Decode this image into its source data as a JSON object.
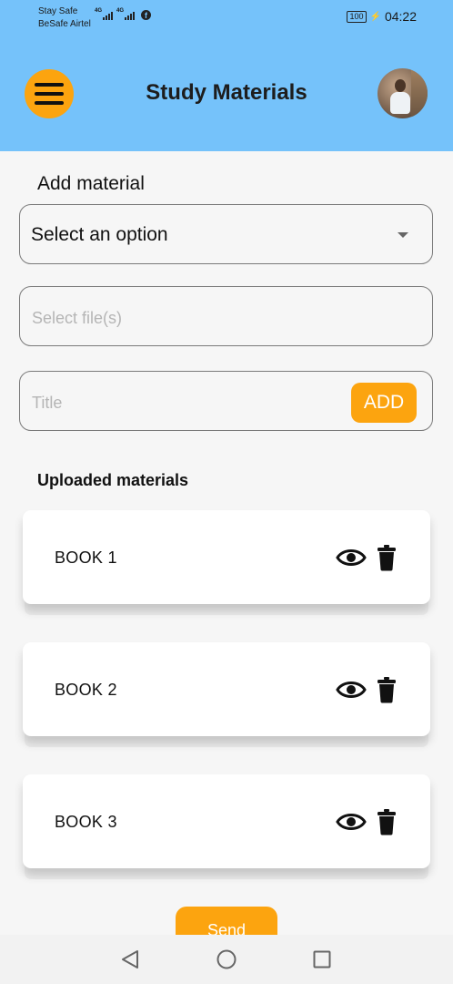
{
  "status_bar": {
    "carrier_line1": "Stay Safe",
    "carrier_line2": "BeSafe Airtel",
    "network1": "4G",
    "network2": "4G",
    "battery": "100",
    "time": "04:22"
  },
  "header": {
    "title": "Study Materials",
    "menu_icon": "hamburger-menu-icon",
    "avatar_icon": "user-profile-photo",
    "background_color": "#75c2fa",
    "accent_color": "#fca40f"
  },
  "form": {
    "section_label": "Add material",
    "select_value": "Select an option",
    "file_placeholder": "Select file(s)",
    "title_placeholder": "Title",
    "add_label": "ADD"
  },
  "uploaded": {
    "label": "Uploaded materials",
    "items": [
      {
        "name": "BOOK 1",
        "view_icon": "eye-icon",
        "delete_icon": "trash-icon"
      },
      {
        "name": "BOOK 2",
        "view_icon": "eye-icon",
        "delete_icon": "trash-icon"
      },
      {
        "name": "BOOK 3",
        "view_icon": "eye-icon",
        "delete_icon": "trash-icon"
      }
    ]
  },
  "send_label": "Send",
  "nav": {
    "back_icon": "back-triangle-icon",
    "home_icon": "home-circle-icon",
    "recents_icon": "recents-square-icon"
  }
}
